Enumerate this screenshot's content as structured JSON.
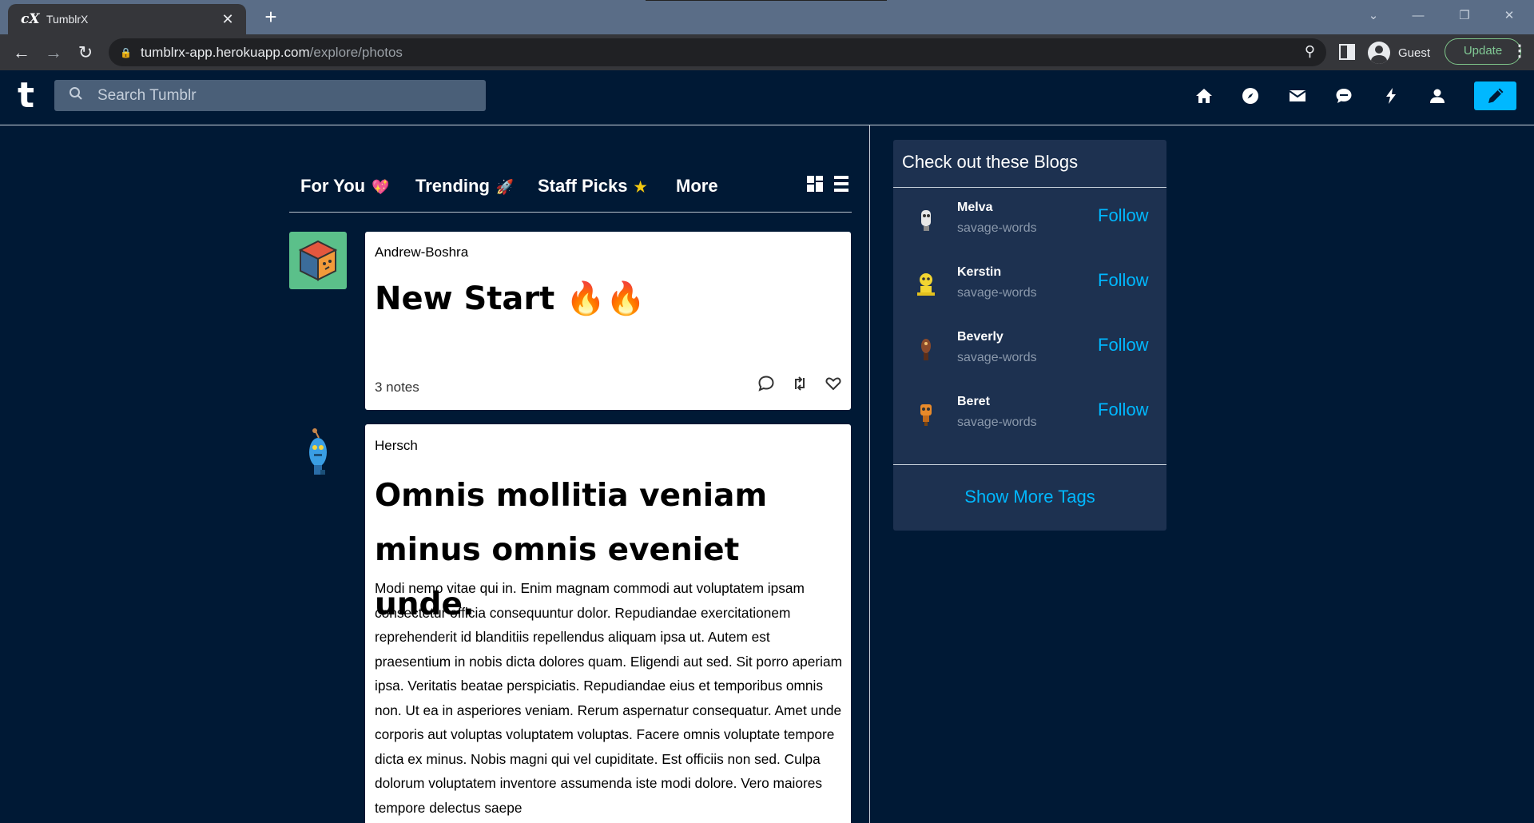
{
  "browser": {
    "tab_title": "TumblrX",
    "tab_favicon": "cX",
    "url_host": "tumblrx-app.herokuapp.com",
    "url_path": "/explore/photos",
    "profile_name": "Guest",
    "update_label": "Update"
  },
  "header": {
    "logo": "t",
    "search_placeholder": "Search Tumblr",
    "icons": [
      "home-icon",
      "explore-icon",
      "mail-icon",
      "chat-icon",
      "lightning-icon",
      "account-icon",
      "compose-pencil-icon"
    ],
    "accent": "#00b8ff"
  },
  "feed": {
    "tabs": [
      {
        "label": "For You",
        "emoji": "💖"
      },
      {
        "label": "Trending",
        "emoji": "🚀"
      },
      {
        "label": "Staff Picks",
        "emoji": "★"
      },
      {
        "label": "More",
        "emoji": ""
      }
    ],
    "posts": [
      {
        "author": "Andrew-Boshra",
        "title": "New Start 🔥🔥",
        "notes": "3 notes"
      },
      {
        "author": "Hersch",
        "title": "Omnis mollitia veniam minus omnis eveniet unde.",
        "body": "Modi nemo vitae qui in. Enim magnam commodi aut voluptatem ipsam consectetur officia consequuntur dolor. Repudiandae exercitationem reprehenderit id blanditiis repellendus aliquam ipsa ut. Autem est praesentium in nobis dicta dolores quam. Eligendi aut sed. Sit porro aperiam ipsa. Veritatis beatae perspiciatis. Repudiandae eius et temporibus omnis non. Ut ea in asperiores veniam. Rerum aspernatur consequatur. Amet unde corporis aut voluptas voluptatem voluptas. Facere omnis voluptate tempore dicta ex minus. Nobis magni qui vel cupiditate. Est officiis non sed. Culpa dolorum voluptatem inventore assumenda iste modi dolore. Vero maiores tempore delectus saepe"
      }
    ]
  },
  "sidebar": {
    "title": "Check out these Blogs",
    "blogs": [
      {
        "name": "Melva",
        "sub": "savage-words",
        "action": "Follow"
      },
      {
        "name": "Kerstin",
        "sub": "savage-words",
        "action": "Follow"
      },
      {
        "name": "Beverly",
        "sub": "savage-words",
        "action": "Follow"
      },
      {
        "name": "Beret",
        "sub": "savage-words",
        "action": "Follow"
      }
    ],
    "show_more": "Show More Tags"
  }
}
